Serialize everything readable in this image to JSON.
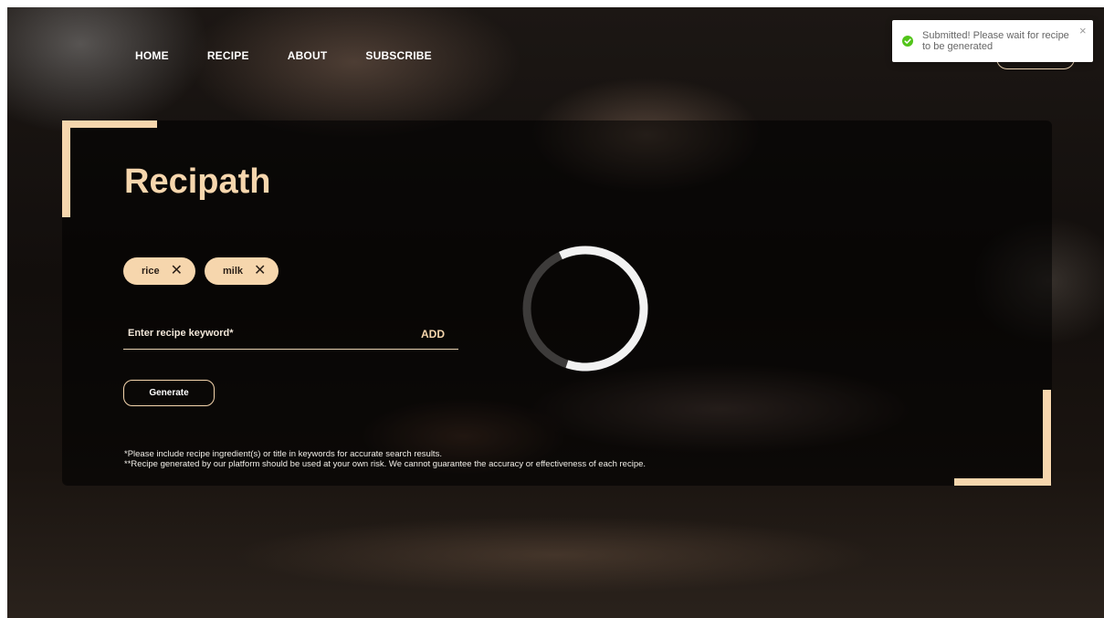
{
  "nav": {
    "items": [
      {
        "label": "HOME"
      },
      {
        "label": "RECIPE"
      },
      {
        "label": "ABOUT"
      },
      {
        "label": "SUBSCRIBE"
      }
    ]
  },
  "hero": {
    "title": "Recipath"
  },
  "chips": [
    {
      "label": "rice",
      "remove_icon": "close-icon"
    },
    {
      "label": "milk",
      "remove_icon": "close-icon"
    }
  ],
  "keyword_input": {
    "value": "",
    "placeholder": "Enter recipe keyword*"
  },
  "add_button": {
    "label": "ADD"
  },
  "generate_button": {
    "label": "Generate"
  },
  "notes": [
    "*Please include recipe ingredient(s) or title in keywords for accurate search results.",
    "**Recipe generated by our platform should be used at your own risk. We cannot guarantee the accuracy or effectiveness of each recipe."
  ],
  "spinner": {
    "icon": "loading-spinner-icon",
    "progress": 0.62
  },
  "toast": {
    "icon": "check-circle-icon",
    "message": "Submitted! Please wait for recipe to be generated",
    "close": "×"
  },
  "colors": {
    "accent": "#f6d6ad",
    "success": "#52c41a"
  }
}
